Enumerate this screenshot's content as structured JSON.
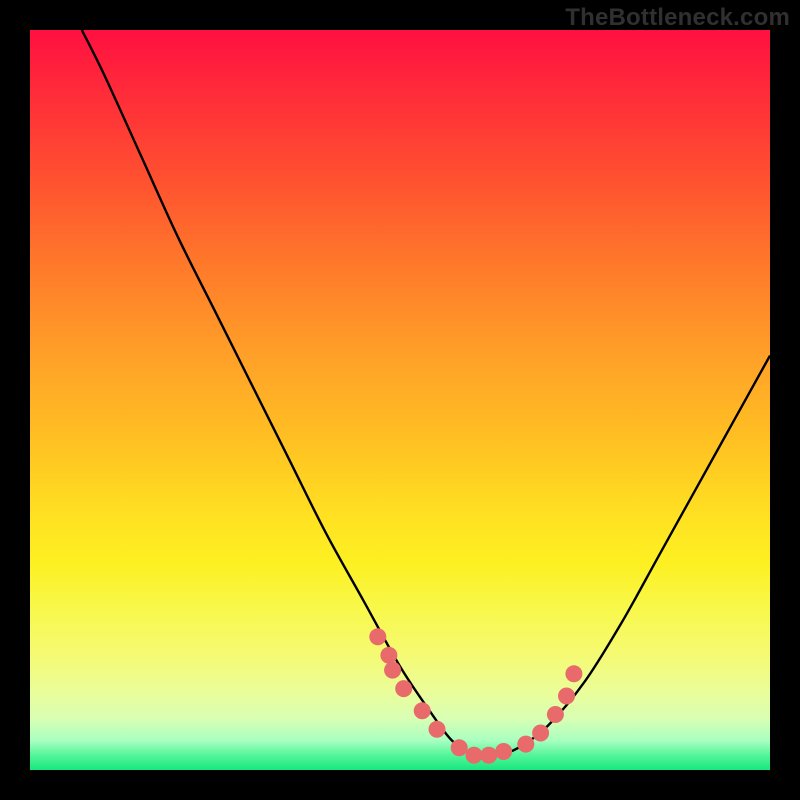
{
  "watermark": "TheBottleneck.com",
  "colors": {
    "background": "#000000",
    "curve_stroke": "#000000",
    "marker_fill": "#e86a6a",
    "gradient_top": "#ff1040",
    "gradient_bottom": "#17e77e"
  },
  "chart_data": {
    "type": "line",
    "title": "",
    "xlabel": "",
    "ylabel": "",
    "xlim": [
      0,
      100
    ],
    "ylim": [
      0,
      100
    ],
    "grid": false,
    "legend": false,
    "note": "values are approximate percentages read from an unlabeled axis (0=bottom/left, 100=top/right); curve is a V with minimum near x≈60",
    "series": [
      {
        "name": "curve",
        "style": "line",
        "x": [
          7,
          10,
          15,
          20,
          25,
          30,
          35,
          40,
          45,
          50,
          54,
          57,
          60,
          63,
          66,
          70,
          75,
          80,
          85,
          90,
          95,
          100
        ],
        "values": [
          100,
          94,
          83,
          72,
          62,
          52,
          42,
          32,
          23,
          14,
          8,
          4,
          2,
          2,
          3,
          6,
          12,
          20,
          29,
          38,
          47,
          56
        ]
      },
      {
        "name": "marker-cluster",
        "style": "points",
        "x": [
          47,
          48.5,
          49,
          50.5,
          53,
          55,
          58,
          60,
          62,
          64,
          67,
          69,
          71,
          72.5,
          73.5
        ],
        "values": [
          18,
          15.5,
          13.5,
          11,
          8,
          5.5,
          3,
          2,
          2,
          2.5,
          3.5,
          5,
          7.5,
          10,
          13
        ]
      }
    ]
  }
}
